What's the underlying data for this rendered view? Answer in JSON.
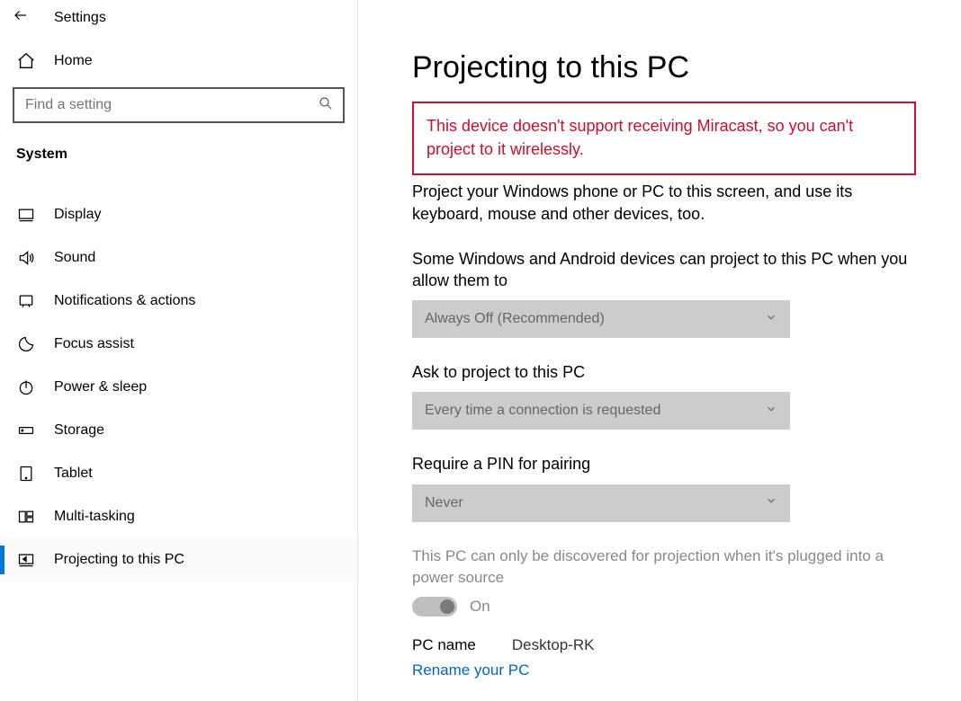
{
  "titlebar": {
    "app_name": "Settings"
  },
  "home": {
    "label": "Home"
  },
  "search": {
    "placeholder": "Find a setting"
  },
  "category": {
    "label": "System"
  },
  "nav": {
    "items": [
      {
        "label": "Display"
      },
      {
        "label": "Sound"
      },
      {
        "label": "Notifications & actions"
      },
      {
        "label": "Focus assist"
      },
      {
        "label": "Power & sleep"
      },
      {
        "label": "Storage"
      },
      {
        "label": "Tablet"
      },
      {
        "label": "Multi-tasking"
      },
      {
        "label": "Projecting to this PC"
      }
    ],
    "selected_index": 8
  },
  "page": {
    "title": "Projecting to this PC",
    "error": "This device doesn't support receiving Miracast, so you can't project to it wirelessly.",
    "description": "Project your Windows phone or PC to this screen, and use its keyboard, mouse and other devices, too.",
    "setting_allow": {
      "label": "Some Windows and Android devices can project to this PC when you allow them to",
      "value": "Always Off (Recommended)"
    },
    "setting_ask": {
      "label": "Ask to project to this PC",
      "value": "Every time a connection is requested"
    },
    "setting_pin": {
      "label": "Require a PIN for pairing",
      "value": "Never"
    },
    "discover_note": "This PC can only be discovered for projection when it's plugged into a power source",
    "toggle_label": "On",
    "pc_name_key": "PC name",
    "pc_name_value": "Desktop-RK",
    "rename_link": "Rename your PC"
  }
}
